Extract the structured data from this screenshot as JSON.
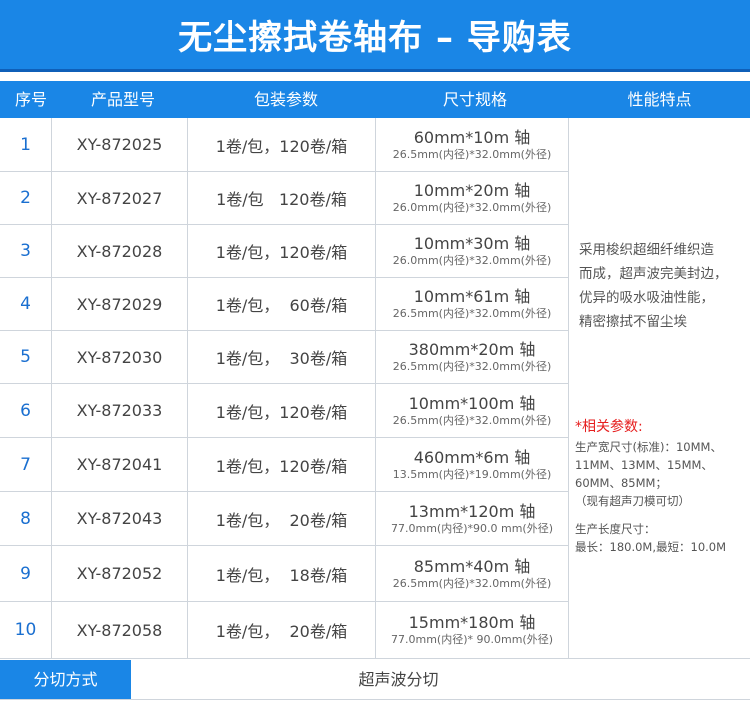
{
  "title": "无尘擦拭卷轴布 – 导购表",
  "headers": [
    "序号",
    "产品型号",
    "包装参数",
    "尺寸规格",
    "性能特点"
  ],
  "rows": [
    {
      "idx": "1",
      "model": "XY-872025",
      "pack": "1卷/包，120卷/箱",
      "size": "60mm*10m 轴",
      "core": "26.5mm(内径)*32.0mm(外径)"
    },
    {
      "idx": "2",
      "model": "XY-872027",
      "pack": "1卷/包   120卷/箱",
      "size": "10mm*20m 轴",
      "core": "26.0mm(内径)*32.0mm(外径)"
    },
    {
      "idx": "3",
      "model": "XY-872028",
      "pack": "1卷/包，120卷/箱",
      "size": "10mm*30m 轴",
      "core": "26.0mm(内径)*32.0mm(外径)"
    },
    {
      "idx": "4",
      "model": "XY-872029",
      "pack": "1卷/包，  60卷/箱",
      "size": "10mm*61m 轴",
      "core": "26.5mm(内径)*32.0mm(外径)"
    },
    {
      "idx": "5",
      "model": "XY-872030",
      "pack": "1卷/包，  30卷/箱",
      "size": "380mm*20m 轴",
      "core": "26.5mm(内径)*32.0mm(外径)"
    },
    {
      "idx": "6",
      "model": "XY-872033",
      "pack": "1卷/包，120卷/箱",
      "size": "10mm*100m 轴",
      "core": "26.5mm(内径)*32.0mm(外径)"
    },
    {
      "idx": "7",
      "model": "XY-872041",
      "pack": "1卷/包，120卷/箱",
      "size": "460mm*6m 轴",
      "core": "13.5mm(内径)*19.0mm(外径)"
    },
    {
      "idx": "8",
      "model": "XY-872043",
      "pack": "1卷/包，  20卷/箱",
      "size": "13mm*120m 轴",
      "core": "77.0mm(内径)*90.0 mm(外径)"
    },
    {
      "idx": "9",
      "model": "XY-872052",
      "pack": "1卷/包，  18卷/箱",
      "size": "85mm*40m 轴",
      "core": "26.5mm(内径)*32.0mm(外径)"
    },
    {
      "idx": "10",
      "model": "XY-872058",
      "pack": "1卷/包，  20卷/箱",
      "size": "15mm*180m 轴",
      "core": "77.0mm(内径)* 90.0mm(外径)"
    }
  ],
  "features": {
    "lines": [
      "采用梭织超细纤维织造",
      "而成，超声波完美封边，",
      "优异的吸水吸油性能，",
      "精密擦拭不留尘埃"
    ]
  },
  "params": {
    "title": "*相关参数:",
    "lines": [
      "生产宽尺寸(标准)：10MM、",
      "11MM、13MM、15MM、",
      "60MM、85MM；",
      "（现有超声刀模可切）",
      "生产长度尺寸：",
      "最长：180.0M,最短：10.0M"
    ]
  },
  "footer": {
    "label": "分切方式",
    "value": "超声波分切"
  },
  "colors": {
    "accent": "#1a86e6",
    "accent_dark": "#0f5fb8",
    "index_text": "#1a6fd0",
    "params_title": "#e61e1e",
    "grid": "#cfd5dc"
  }
}
